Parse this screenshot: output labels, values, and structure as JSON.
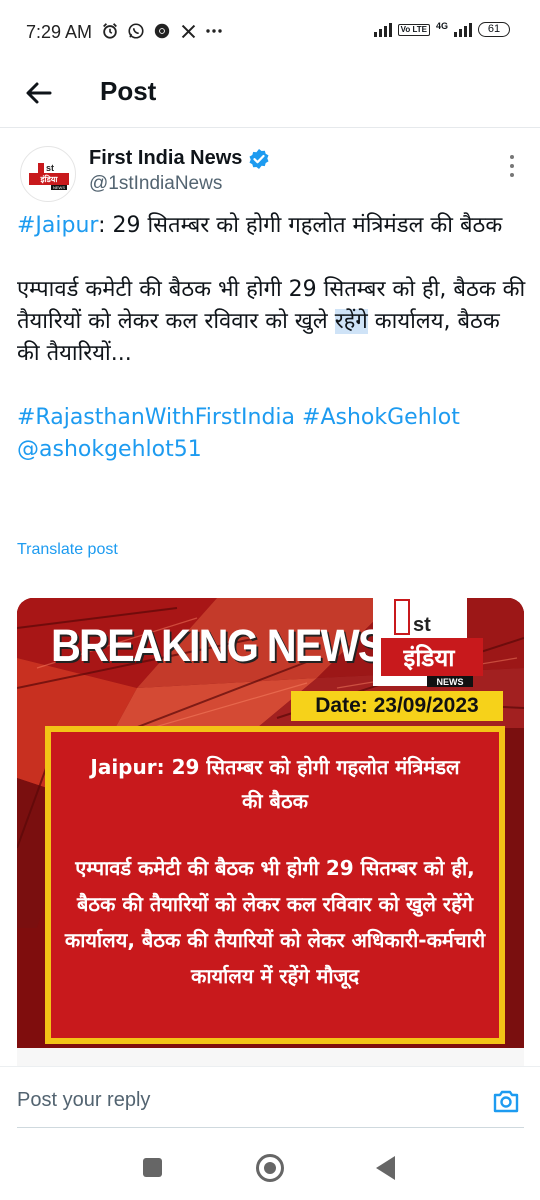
{
  "status_bar": {
    "time": "7:29 AM",
    "notification_icons": [
      "alarm-icon",
      "whatsapp-icon",
      "chrome-icon",
      "x-icon",
      "more-dots-icon"
    ],
    "network": "4G",
    "volte": "Vo LTE",
    "battery": "61"
  },
  "header": {
    "title": "Post",
    "back_icon": "arrow-left-icon"
  },
  "author": {
    "name": "First India News",
    "handle": "@1stIndiaNews",
    "verified": true,
    "avatar_text": "1st इंडिया NEWS"
  },
  "tweet": {
    "line1_hashtag": "#Jaipur",
    "line1_rest": ": 29 सितम्बर को होगी गहलोत मंत्रिमंडल की बैठक",
    "para2_before": "एम्पावर्ड कमेटी की बैठक भी होगी 29 सितम्बर को ही, बैठक की तैयारियों को लेकर कल रविवार को खुले ",
    "para2_highlight": "रहेंगे",
    "para2_after": " कार्यालय, बैठक की तैयारियों...",
    "hashtag1": "#RajasthanWithFirstIndia",
    "hashtag2": "#AshokGehlot",
    "mention": "@ashokgehlot51",
    "translate": "Translate post"
  },
  "media": {
    "banner": "BREAKING NEWS",
    "logo_1st": "1st",
    "logo_india": "इंडिया",
    "logo_news": "NEWS",
    "date": "Date: 23/09/2023",
    "headline": "Jaipur: 29 सितम्बर को होगी गहलोत मंत्रिमंडल की बैठक",
    "body": "एम्पावर्ड कमेटी की बैठक भी होगी 29 सितम्बर को ही, बैठक की तैयारियों को लेकर कल रविवार को खुले रहेंगे कार्यालय, बैठक की तैयारियों को लेकर अधिकारी-कर्मचारी कार्यालय में रहेंगे मौजूद",
    "colors": {
      "card": "#c8191c",
      "border": "#f3c316",
      "date_bg": "#f6d21a"
    }
  },
  "reply": {
    "placeholder": "Post your reply",
    "camera_icon": "camera-icon"
  },
  "nav": {
    "icons": [
      "recents-square-icon",
      "home-circle-icon",
      "back-triangle-icon"
    ]
  },
  "colors": {
    "link": "#1d9bf0",
    "text": "#0f1419",
    "muted": "#536471"
  }
}
